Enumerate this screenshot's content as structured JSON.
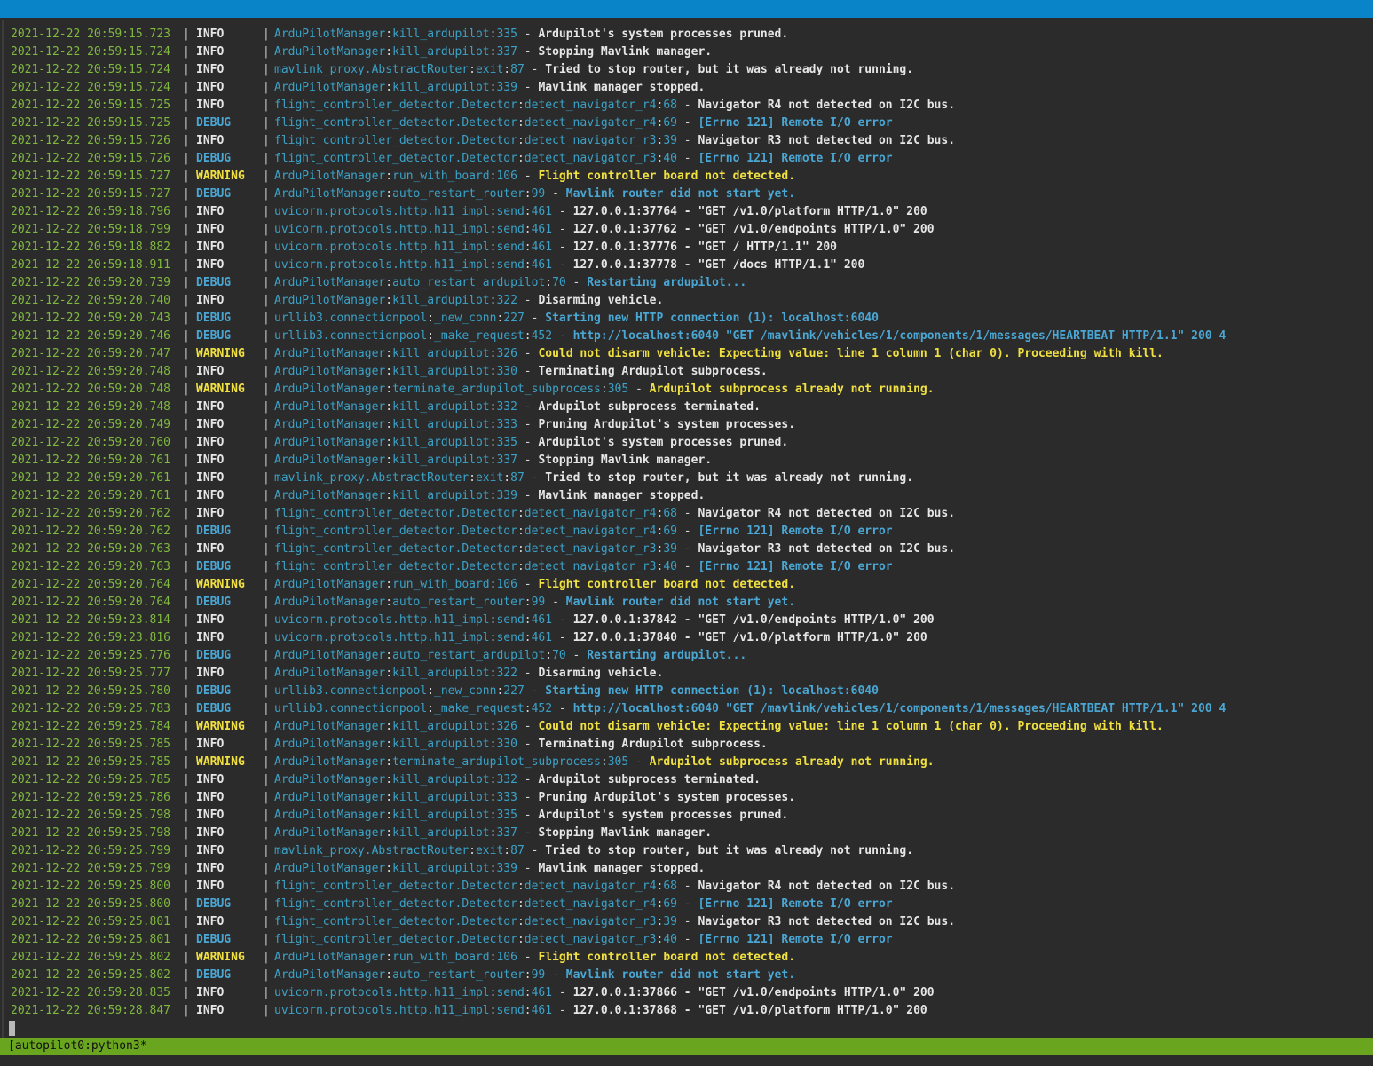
{
  "status_bar": {
    "label": "[autopilot0:python3*"
  },
  "colors": {
    "timestamp": "#7fb93f",
    "module": "#3ba1c6",
    "info": "#e6e6e6",
    "debug": "#4aa6d3",
    "warning": "#f0e040",
    "status_bar": "#6aa51f",
    "title_bar": "#0a84c8"
  },
  "log_lines": [
    {
      "ts": "2021-12-22 20:59:15.723",
      "level": "INFO",
      "mod": "ArduPilotManager",
      "func": "kill_ardupilot",
      "line": "335",
      "msg": "Ardupilot's system processes pruned."
    },
    {
      "ts": "2021-12-22 20:59:15.724",
      "level": "INFO",
      "mod": "ArduPilotManager",
      "func": "kill_ardupilot",
      "line": "337",
      "msg": "Stopping Mavlink manager."
    },
    {
      "ts": "2021-12-22 20:59:15.724",
      "level": "INFO",
      "mod": "mavlink_proxy.AbstractRouter",
      "func": "exit",
      "line": "87",
      "msg": "Tried to stop router, but it was already not running."
    },
    {
      "ts": "2021-12-22 20:59:15.724",
      "level": "INFO",
      "mod": "ArduPilotManager",
      "func": "kill_ardupilot",
      "line": "339",
      "msg": "Mavlink manager stopped."
    },
    {
      "ts": "2021-12-22 20:59:15.725",
      "level": "INFO",
      "mod": "flight_controller_detector.Detector",
      "func": "detect_navigator_r4",
      "line": "68",
      "msg": "Navigator R4 not detected on I2C bus."
    },
    {
      "ts": "2021-12-22 20:59:15.725",
      "level": "DEBUG",
      "mod": "flight_controller_detector.Detector",
      "func": "detect_navigator_r4",
      "line": "69",
      "msg": "[Errno 121] Remote I/O error"
    },
    {
      "ts": "2021-12-22 20:59:15.726",
      "level": "INFO",
      "mod": "flight_controller_detector.Detector",
      "func": "detect_navigator_r3",
      "line": "39",
      "msg": "Navigator R3 not detected on I2C bus."
    },
    {
      "ts": "2021-12-22 20:59:15.726",
      "level": "DEBUG",
      "mod": "flight_controller_detector.Detector",
      "func": "detect_navigator_r3",
      "line": "40",
      "msg": "[Errno 121] Remote I/O error"
    },
    {
      "ts": "2021-12-22 20:59:15.727",
      "level": "WARNING",
      "mod": "ArduPilotManager",
      "func": "run_with_board",
      "line": "106",
      "msg": "Flight controller board not detected."
    },
    {
      "ts": "2021-12-22 20:59:15.727",
      "level": "DEBUG",
      "mod": "ArduPilotManager",
      "func": "auto_restart_router",
      "line": "99",
      "msg": "Mavlink router did not start yet."
    },
    {
      "ts": "2021-12-22 20:59:18.796",
      "level": "INFO",
      "mod": "uvicorn.protocols.http.h11_impl",
      "func": "send",
      "line": "461",
      "msg": "127.0.0.1:37764 - \"GET /v1.0/platform HTTP/1.0\" 200"
    },
    {
      "ts": "2021-12-22 20:59:18.799",
      "level": "INFO",
      "mod": "uvicorn.protocols.http.h11_impl",
      "func": "send",
      "line": "461",
      "msg": "127.0.0.1:37762 - \"GET /v1.0/endpoints HTTP/1.0\" 200"
    },
    {
      "ts": "2021-12-22 20:59:18.882",
      "level": "INFO",
      "mod": "uvicorn.protocols.http.h11_impl",
      "func": "send",
      "line": "461",
      "msg": "127.0.0.1:37776 - \"GET / HTTP/1.1\" 200"
    },
    {
      "ts": "2021-12-22 20:59:18.911",
      "level": "INFO",
      "mod": "uvicorn.protocols.http.h11_impl",
      "func": "send",
      "line": "461",
      "msg": "127.0.0.1:37778 - \"GET /docs HTTP/1.1\" 200"
    },
    {
      "ts": "2021-12-22 20:59:20.739",
      "level": "DEBUG",
      "mod": "ArduPilotManager",
      "func": "auto_restart_ardupilot",
      "line": "70",
      "msg": "Restarting ardupilot..."
    },
    {
      "ts": "2021-12-22 20:59:20.740",
      "level": "INFO",
      "mod": "ArduPilotManager",
      "func": "kill_ardupilot",
      "line": "322",
      "msg": "Disarming vehicle."
    },
    {
      "ts": "2021-12-22 20:59:20.743",
      "level": "DEBUG",
      "mod": "urllib3.connectionpool",
      "func": "_new_conn",
      "line": "227",
      "msg": "Starting new HTTP connection (1): localhost:6040"
    },
    {
      "ts": "2021-12-22 20:59:20.746",
      "level": "DEBUG",
      "mod": "urllib3.connectionpool",
      "func": "_make_request",
      "line": "452",
      "msg": "http://localhost:6040 \"GET /mavlink/vehicles/1/components/1/messages/HEARTBEAT HTTP/1.1\" 200 4"
    },
    {
      "ts": "2021-12-22 20:59:20.747",
      "level": "WARNING",
      "mod": "ArduPilotManager",
      "func": "kill_ardupilot",
      "line": "326",
      "msg": "Could not disarm vehicle: Expecting value: line 1 column 1 (char 0). Proceeding with kill."
    },
    {
      "ts": "2021-12-22 20:59:20.748",
      "level": "INFO",
      "mod": "ArduPilotManager",
      "func": "kill_ardupilot",
      "line": "330",
      "msg": "Terminating Ardupilot subprocess."
    },
    {
      "ts": "2021-12-22 20:59:20.748",
      "level": "WARNING",
      "mod": "ArduPilotManager",
      "func": "terminate_ardupilot_subprocess",
      "line": "305",
      "msg": "Ardupilot subprocess already not running."
    },
    {
      "ts": "2021-12-22 20:59:20.748",
      "level": "INFO",
      "mod": "ArduPilotManager",
      "func": "kill_ardupilot",
      "line": "332",
      "msg": "Ardupilot subprocess terminated."
    },
    {
      "ts": "2021-12-22 20:59:20.749",
      "level": "INFO",
      "mod": "ArduPilotManager",
      "func": "kill_ardupilot",
      "line": "333",
      "msg": "Pruning Ardupilot's system processes."
    },
    {
      "ts": "2021-12-22 20:59:20.760",
      "level": "INFO",
      "mod": "ArduPilotManager",
      "func": "kill_ardupilot",
      "line": "335",
      "msg": "Ardupilot's system processes pruned."
    },
    {
      "ts": "2021-12-22 20:59:20.761",
      "level": "INFO",
      "mod": "ArduPilotManager",
      "func": "kill_ardupilot",
      "line": "337",
      "msg": "Stopping Mavlink manager."
    },
    {
      "ts": "2021-12-22 20:59:20.761",
      "level": "INFO",
      "mod": "mavlink_proxy.AbstractRouter",
      "func": "exit",
      "line": "87",
      "msg": "Tried to stop router, but it was already not running."
    },
    {
      "ts": "2021-12-22 20:59:20.761",
      "level": "INFO",
      "mod": "ArduPilotManager",
      "func": "kill_ardupilot",
      "line": "339",
      "msg": "Mavlink manager stopped."
    },
    {
      "ts": "2021-12-22 20:59:20.762",
      "level": "INFO",
      "mod": "flight_controller_detector.Detector",
      "func": "detect_navigator_r4",
      "line": "68",
      "msg": "Navigator R4 not detected on I2C bus."
    },
    {
      "ts": "2021-12-22 20:59:20.762",
      "level": "DEBUG",
      "mod": "flight_controller_detector.Detector",
      "func": "detect_navigator_r4",
      "line": "69",
      "msg": "[Errno 121] Remote I/O error"
    },
    {
      "ts": "2021-12-22 20:59:20.763",
      "level": "INFO",
      "mod": "flight_controller_detector.Detector",
      "func": "detect_navigator_r3",
      "line": "39",
      "msg": "Navigator R3 not detected on I2C bus."
    },
    {
      "ts": "2021-12-22 20:59:20.763",
      "level": "DEBUG",
      "mod": "flight_controller_detector.Detector",
      "func": "detect_navigator_r3",
      "line": "40",
      "msg": "[Errno 121] Remote I/O error"
    },
    {
      "ts": "2021-12-22 20:59:20.764",
      "level": "WARNING",
      "mod": "ArduPilotManager",
      "func": "run_with_board",
      "line": "106",
      "msg": "Flight controller board not detected."
    },
    {
      "ts": "2021-12-22 20:59:20.764",
      "level": "DEBUG",
      "mod": "ArduPilotManager",
      "func": "auto_restart_router",
      "line": "99",
      "msg": "Mavlink router did not start yet."
    },
    {
      "ts": "2021-12-22 20:59:23.814",
      "level": "INFO",
      "mod": "uvicorn.protocols.http.h11_impl",
      "func": "send",
      "line": "461",
      "msg": "127.0.0.1:37842 - \"GET /v1.0/endpoints HTTP/1.0\" 200"
    },
    {
      "ts": "2021-12-22 20:59:23.816",
      "level": "INFO",
      "mod": "uvicorn.protocols.http.h11_impl",
      "func": "send",
      "line": "461",
      "msg": "127.0.0.1:37840 - \"GET /v1.0/platform HTTP/1.0\" 200"
    },
    {
      "ts": "2021-12-22 20:59:25.776",
      "level": "DEBUG",
      "mod": "ArduPilotManager",
      "func": "auto_restart_ardupilot",
      "line": "70",
      "msg": "Restarting ardupilot..."
    },
    {
      "ts": "2021-12-22 20:59:25.777",
      "level": "INFO",
      "mod": "ArduPilotManager",
      "func": "kill_ardupilot",
      "line": "322",
      "msg": "Disarming vehicle."
    },
    {
      "ts": "2021-12-22 20:59:25.780",
      "level": "DEBUG",
      "mod": "urllib3.connectionpool",
      "func": "_new_conn",
      "line": "227",
      "msg": "Starting new HTTP connection (1): localhost:6040"
    },
    {
      "ts": "2021-12-22 20:59:25.783",
      "level": "DEBUG",
      "mod": "urllib3.connectionpool",
      "func": "_make_request",
      "line": "452",
      "msg": "http://localhost:6040 \"GET /mavlink/vehicles/1/components/1/messages/HEARTBEAT HTTP/1.1\" 200 4"
    },
    {
      "ts": "2021-12-22 20:59:25.784",
      "level": "WARNING",
      "mod": "ArduPilotManager",
      "func": "kill_ardupilot",
      "line": "326",
      "msg": "Could not disarm vehicle: Expecting value: line 1 column 1 (char 0). Proceeding with kill."
    },
    {
      "ts": "2021-12-22 20:59:25.785",
      "level": "INFO",
      "mod": "ArduPilotManager",
      "func": "kill_ardupilot",
      "line": "330",
      "msg": "Terminating Ardupilot subprocess."
    },
    {
      "ts": "2021-12-22 20:59:25.785",
      "level": "WARNING",
      "mod": "ArduPilotManager",
      "func": "terminate_ardupilot_subprocess",
      "line": "305",
      "msg": "Ardupilot subprocess already not running."
    },
    {
      "ts": "2021-12-22 20:59:25.785",
      "level": "INFO",
      "mod": "ArduPilotManager",
      "func": "kill_ardupilot",
      "line": "332",
      "msg": "Ardupilot subprocess terminated."
    },
    {
      "ts": "2021-12-22 20:59:25.786",
      "level": "INFO",
      "mod": "ArduPilotManager",
      "func": "kill_ardupilot",
      "line": "333",
      "msg": "Pruning Ardupilot's system processes."
    },
    {
      "ts": "2021-12-22 20:59:25.798",
      "level": "INFO",
      "mod": "ArduPilotManager",
      "func": "kill_ardupilot",
      "line": "335",
      "msg": "Ardupilot's system processes pruned."
    },
    {
      "ts": "2021-12-22 20:59:25.798",
      "level": "INFO",
      "mod": "ArduPilotManager",
      "func": "kill_ardupilot",
      "line": "337",
      "msg": "Stopping Mavlink manager."
    },
    {
      "ts": "2021-12-22 20:59:25.799",
      "level": "INFO",
      "mod": "mavlink_proxy.AbstractRouter",
      "func": "exit",
      "line": "87",
      "msg": "Tried to stop router, but it was already not running."
    },
    {
      "ts": "2021-12-22 20:59:25.799",
      "level": "INFO",
      "mod": "ArduPilotManager",
      "func": "kill_ardupilot",
      "line": "339",
      "msg": "Mavlink manager stopped."
    },
    {
      "ts": "2021-12-22 20:59:25.800",
      "level": "INFO",
      "mod": "flight_controller_detector.Detector",
      "func": "detect_navigator_r4",
      "line": "68",
      "msg": "Navigator R4 not detected on I2C bus."
    },
    {
      "ts": "2021-12-22 20:59:25.800",
      "level": "DEBUG",
      "mod": "flight_controller_detector.Detector",
      "func": "detect_navigator_r4",
      "line": "69",
      "msg": "[Errno 121] Remote I/O error"
    },
    {
      "ts": "2021-12-22 20:59:25.801",
      "level": "INFO",
      "mod": "flight_controller_detector.Detector",
      "func": "detect_navigator_r3",
      "line": "39",
      "msg": "Navigator R3 not detected on I2C bus."
    },
    {
      "ts": "2021-12-22 20:59:25.801",
      "level": "DEBUG",
      "mod": "flight_controller_detector.Detector",
      "func": "detect_navigator_r3",
      "line": "40",
      "msg": "[Errno 121] Remote I/O error"
    },
    {
      "ts": "2021-12-22 20:59:25.802",
      "level": "WARNING",
      "mod": "ArduPilotManager",
      "func": "run_with_board",
      "line": "106",
      "msg": "Flight controller board not detected."
    },
    {
      "ts": "2021-12-22 20:59:25.802",
      "level": "DEBUG",
      "mod": "ArduPilotManager",
      "func": "auto_restart_router",
      "line": "99",
      "msg": "Mavlink router did not start yet."
    },
    {
      "ts": "2021-12-22 20:59:28.835",
      "level": "INFO",
      "mod": "uvicorn.protocols.http.h11_impl",
      "func": "send",
      "line": "461",
      "msg": "127.0.0.1:37866 - \"GET /v1.0/endpoints HTTP/1.0\" 200"
    },
    {
      "ts": "2021-12-22 20:59:28.847",
      "level": "INFO",
      "mod": "uvicorn.protocols.http.h11_impl",
      "func": "send",
      "line": "461",
      "msg": "127.0.0.1:37868 - \"GET /v1.0/platform HTTP/1.0\" 200"
    }
  ]
}
